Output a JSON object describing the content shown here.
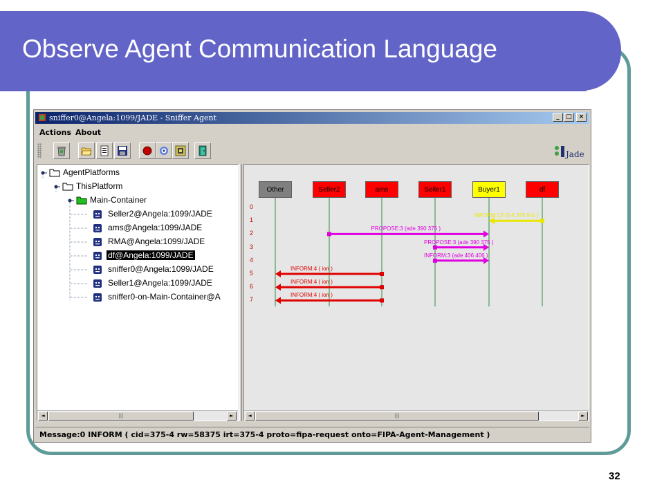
{
  "slide": {
    "title": "Observe Agent Communication Language",
    "page_number": "32"
  },
  "window": {
    "title": "sniffer0@Angela:1099/JADE - Sniffer Agent",
    "controls": {
      "minimize": "_",
      "maximize": "□",
      "close": "×"
    }
  },
  "menu": {
    "items": [
      "Actions",
      "About"
    ]
  },
  "toolbar": {
    "buttons": [
      "trash-icon",
      "open-folder-icon",
      "doc-icon",
      "save-icon",
      "record-icon",
      "spiral-icon",
      "target-icon",
      "exit-door-icon"
    ],
    "logo_text": "Jade"
  },
  "tree": {
    "nodes": [
      {
        "label": "AgentPlatforms",
        "icon": "folder-icon",
        "level": 0
      },
      {
        "label": "ThisPlatform",
        "icon": "folder-icon",
        "level": 1
      },
      {
        "label": "Main-Container",
        "icon": "folder-green-icon",
        "level": 2
      },
      {
        "label": "Seller2@Angela:1099/JADE",
        "icon": "agent-icon",
        "level": 3
      },
      {
        "label": "ams@Angela:1099/JADE",
        "icon": "agent-icon",
        "level": 3
      },
      {
        "label": "RMA@Angela:1099/JADE",
        "icon": "agent-icon",
        "level": 3
      },
      {
        "label": "df@Angela:1099/JADE",
        "icon": "agent-icon",
        "level": 3,
        "selected": true
      },
      {
        "label": "sniffer0@Angela:1099/JADE",
        "icon": "agent-icon",
        "level": 3
      },
      {
        "label": "Seller1@Angela:1099/JADE",
        "icon": "agent-icon",
        "level": 3
      },
      {
        "label": "sniffer0-on-Main-Container@A",
        "icon": "agent-icon",
        "level": 3
      }
    ]
  },
  "sniffer": {
    "agents": [
      {
        "name": "Other",
        "color": "#808080"
      },
      {
        "name": "Seller2",
        "color": "#ff0000"
      },
      {
        "name": "ams",
        "color": "#ff0000"
      },
      {
        "name": "Seller1",
        "color": "#ff0000"
      },
      {
        "name": "Buyer1",
        "color": "#ffff00"
      },
      {
        "name": "df",
        "color": "#ff0000"
      }
    ],
    "row_numbers": [
      "0",
      "1",
      "2",
      "3",
      "4",
      "5",
      "6",
      "7"
    ],
    "messages": [
      {
        "row": 1,
        "from": 5,
        "to": 4,
        "label": "INFORM:12 (5-4  375  5-4 )",
        "color": "#e8e800"
      },
      {
        "row": 2,
        "from": 1,
        "to": 4,
        "label": "PROPOSE:3 (ade  390  375 )",
        "color": "#e000e0"
      },
      {
        "row": 3,
        "from": 3,
        "to": 4,
        "label": "PROPOSE:3 (ade  390  375 )",
        "color": "#e000e0"
      },
      {
        "row": 4,
        "from": 3,
        "to": 4,
        "label": "INFORM:3 (ade  406  406 )",
        "color": "#e000e0"
      },
      {
        "row": 5,
        "from": 2,
        "to": 0,
        "label": "INFORM:4 (      ion )",
        "color": "#e00000"
      },
      {
        "row": 6,
        "from": 2,
        "to": 0,
        "label": "INFORM:4 (      ion )",
        "color": "#e00000"
      },
      {
        "row": 7,
        "from": 2,
        "to": 0,
        "label": "INFORM:4 (      ion )",
        "color": "#e00000"
      }
    ]
  },
  "status": {
    "text": "Message:0 INFORM ( cid=375-4 rw=58375 irt=375-4 proto=fipa-request onto=FIPA-Agent-Management )"
  },
  "scroll": {
    "arrow_left": "◄",
    "arrow_right": "►",
    "thumb_grip": "|||"
  }
}
